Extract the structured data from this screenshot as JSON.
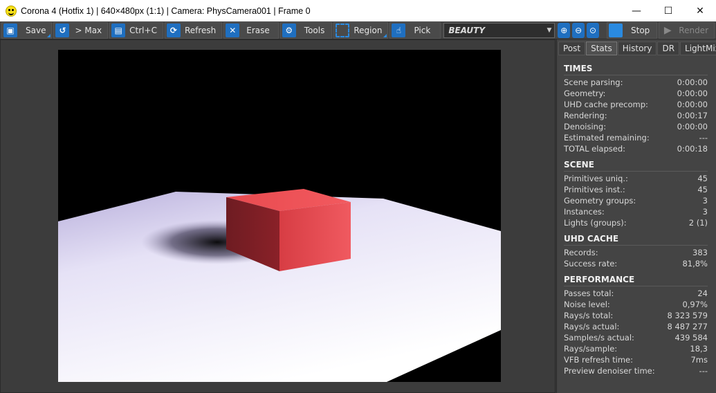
{
  "window": {
    "title": "Corona 4 (Hotfix 1) | 640×480px (1:1) | Camera: PhysCamera001 | Frame 0",
    "controls": [
      "—",
      "☐",
      "✕"
    ]
  },
  "toolbar": {
    "save": "Save",
    "max": "> Max",
    "ctrlc": "Ctrl+C",
    "refresh": "Refresh",
    "erase": "Erase",
    "tools": "Tools",
    "region": "Region",
    "pick": "Pick",
    "pass": "BEAUTY",
    "stop": "Stop",
    "render": "Render"
  },
  "panel": {
    "tabs": [
      "Post",
      "Stats",
      "History",
      "DR",
      "LightMix"
    ],
    "active_tab": "Stats",
    "sections": {
      "times": {
        "title": "TIMES",
        "rows": [
          {
            "label": "Scene parsing:",
            "value": "0:00:00"
          },
          {
            "label": "Geometry:",
            "value": "0:00:00"
          },
          {
            "label": "UHD cache precomp:",
            "value": "0:00:00"
          },
          {
            "label": "Rendering:",
            "value": "0:00:17"
          },
          {
            "label": "Denoising:",
            "value": "0:00:00"
          },
          {
            "label": "Estimated remaining:",
            "value": "---"
          },
          {
            "label": "TOTAL elapsed:",
            "value": "0:00:18"
          }
        ]
      },
      "scene": {
        "title": "SCENE",
        "rows": [
          {
            "label": "Primitives uniq.:",
            "value": "45"
          },
          {
            "label": "Primitives inst.:",
            "value": "45"
          },
          {
            "label": "Geometry groups:",
            "value": "3"
          },
          {
            "label": "Instances:",
            "value": "3"
          },
          {
            "label": "Lights (groups):",
            "value": "2 (1)"
          }
        ]
      },
      "uhd": {
        "title": "UHD CACHE",
        "rows": [
          {
            "label": "Records:",
            "value": "383"
          },
          {
            "label": "Success rate:",
            "value": "81,8%"
          }
        ]
      },
      "performance": {
        "title": "PERFORMANCE",
        "rows": [
          {
            "label": "Passes total:",
            "value": "24"
          },
          {
            "label": "Noise level:",
            "value": "0,97%"
          },
          {
            "label": "Rays/s total:",
            "value": "8 323 579"
          },
          {
            "label": "Rays/s actual:",
            "value": "8 487 277"
          },
          {
            "label": "Samples/s actual:",
            "value": "439 584"
          },
          {
            "label": "Rays/sample:",
            "value": "18,3"
          },
          {
            "label": "VFB refresh time:",
            "value": "7ms"
          },
          {
            "label": "Preview denoiser time:",
            "value": "---"
          }
        ]
      }
    }
  },
  "colors": {
    "accent": "#1f6fc0",
    "cube": "#e8454a",
    "floor": "#f4f2fb",
    "render_bg": "#000000"
  }
}
